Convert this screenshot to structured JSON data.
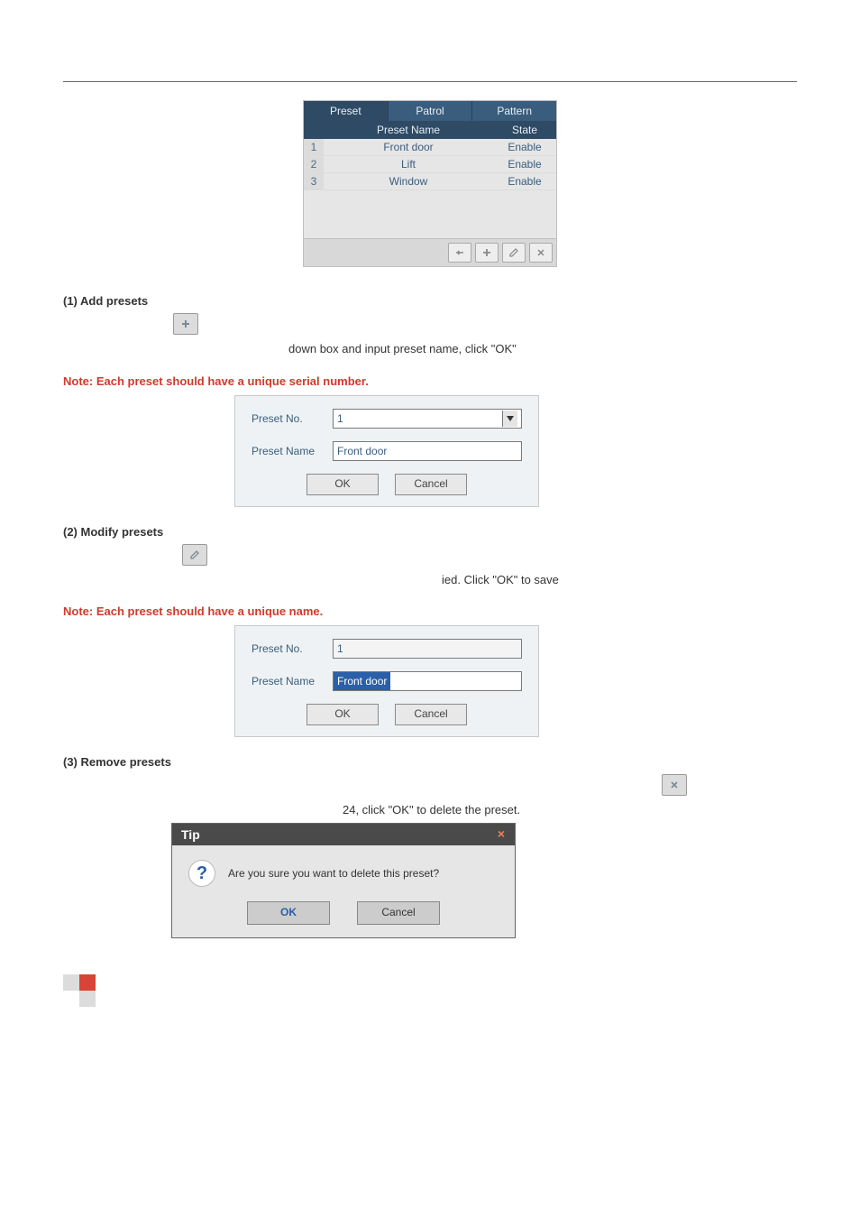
{
  "fig1": {
    "tabs": [
      "Preset",
      "Patrol",
      "Pattern"
    ],
    "columns": {
      "name": "Preset Name",
      "state": "State"
    },
    "rows": [
      {
        "idx": "1",
        "name": "Front door",
        "state": "Enable"
      },
      {
        "idx": "2",
        "name": "Lift",
        "state": "Enable"
      },
      {
        "idx": "3",
        "name": "Window",
        "state": "Enable"
      }
    ]
  },
  "s1": {
    "title": "(1) Add presets",
    "line_b": "down box and input preset name, click \"OK\""
  },
  "note1": "Note: Each preset should have a unique serial number.",
  "dlg1": {
    "no_label": "Preset No.",
    "no_value": "1",
    "name_label": "Preset Name",
    "name_value": "Front door",
    "ok": "OK",
    "cancel": "Cancel"
  },
  "s2": {
    "title": "(2) Modify presets",
    "line_b": "ied. Click \"OK\" to save"
  },
  "note2": "Note: Each preset should have a unique name.",
  "dlg2": {
    "no_label": "Preset No.",
    "no_value": "1",
    "name_label": "Preset Name",
    "name_value": "Front door",
    "ok": "OK",
    "cancel": "Cancel"
  },
  "s3": {
    "title": "(3) Remove presets",
    "line_b": "24, click \"OK\" to delete the preset."
  },
  "tip": {
    "title": "Tip",
    "msg": "Are you sure you want to delete this preset?",
    "ok": "OK",
    "cancel": "Cancel"
  }
}
